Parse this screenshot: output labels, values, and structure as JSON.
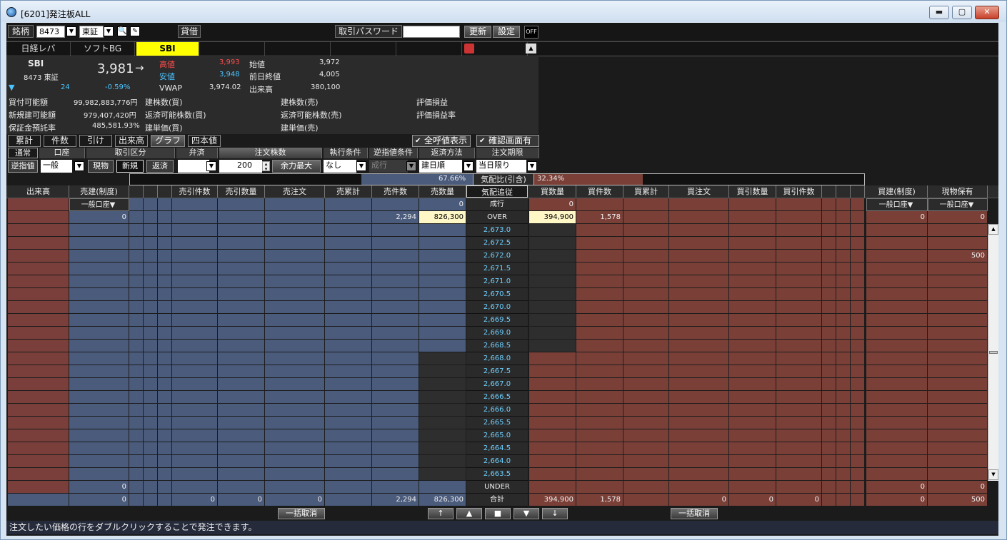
{
  "window": {
    "title": "[6201]発注板ALL",
    "minimize": "▬",
    "maximize": "▢",
    "close": "✕"
  },
  "toolbar": {
    "symbol_label": "銘柄",
    "symbol_value": "8473",
    "market_value": "東証",
    "loan_label": "貸借",
    "password_label": "取引パスワード",
    "password_value": "",
    "refresh": "更新",
    "settings": "設定",
    "off": "OFF"
  },
  "tabs": [
    "日経レバ",
    "ソフトBG",
    "SBI",
    "",
    "",
    "",
    "",
    ""
  ],
  "info": {
    "name": "SBI",
    "code": "8473 東証",
    "price": "3,981",
    "arrow": "→",
    "change": "24",
    "change_pct": "-0.59%",
    "high_label": "高値",
    "high": "3,993",
    "low_label": "安値",
    "low": "3,948",
    "vwap_label": "VWAP",
    "vwap": "3,974.02",
    "open_label": "始値",
    "open": "3,972",
    "prev_label": "前日終値",
    "prev": "4,005",
    "volume_label": "出来高",
    "volume": "380,100",
    "buying_power_label": "買付可能額",
    "buying_power": "99,982,883,776円",
    "new_margin_label": "新規建可能額",
    "new_margin": "979,407,420円",
    "deposit_label": "保証金預託率",
    "deposit": "485,581.93%",
    "pos_buy": "建株数(買)",
    "repay_buy": "返済可能株数(買)",
    "avg_buy": "建単価(買)",
    "pos_sell": "建株数(売)",
    "repay_sell": "返済可能株数(売)",
    "avg_sell": "建単価(売)",
    "eval_pl": "評価損益",
    "eval_pl_rate": "評価損益率"
  },
  "view_buttons": [
    "累計",
    "件数",
    "引け",
    "出来高",
    "グラフ",
    "四本値"
  ],
  "check_all_price": "全呼値表示",
  "check_confirm": "確認画面有",
  "order_headers": [
    "通常",
    "口座",
    "取引区分",
    "弁済",
    "注文株数",
    "執行条件",
    "逆指値条件",
    "返済方法",
    "注文期限"
  ],
  "order_values": {
    "stop": "逆指値",
    "account": "一般",
    "cash": "現物",
    "new": "新規",
    "repay": "返済",
    "bensai": "",
    "qty": "200",
    "max": "余力最大",
    "exec": "なし",
    "stop_cond": "成行",
    "repay_method": "建日順",
    "expiry": "当日限り"
  },
  "ratio": {
    "sell_pct_text": "67.66%",
    "label": "気配比(引含)",
    "buy_pct_text": "32.34%",
    "sell_pct": 67.66,
    "buy_pct": 32.34
  },
  "columns": [
    "出来高",
    "売建(制度)",
    "",
    "",
    "",
    "売引件数",
    "売引数量",
    "売注文",
    "売累計",
    "売件数",
    "売数量",
    "気配追従",
    "買数量",
    "買件数",
    "買累計",
    "買注文",
    "買引数量",
    "買引件数",
    "",
    "",
    "",
    "買建(制度)",
    "現物保有"
  ],
  "sub_header": {
    "sell_account": "一般口座▼",
    "market_order": "成行",
    "buy_account": "一般口座▼",
    "cash_account": "一般口座▼",
    "sell_qty": "0",
    "buy_qty": "0"
  },
  "over_row": {
    "label": "OVER",
    "sell_margin": "0",
    "sell_count": "2,294",
    "sell_qty": "826,300",
    "buy_qty": "394,900",
    "buy_count": "1,578",
    "buy_margin": "0",
    "cash_hold": "0"
  },
  "prices": [
    "2,673.0",
    "2,672.5",
    "2,672.0",
    "2,671.5",
    "2,671.0",
    "2,670.5",
    "2,670.0",
    "2,669.5",
    "2,669.0",
    "2,668.5",
    "2,668.0",
    "2,667.5",
    "2,667.0",
    "2,666.5",
    "2,666.0",
    "2,665.5",
    "2,665.0",
    "2,664.5",
    "2,664.0",
    "2,663.5"
  ],
  "row_cash_value": "500",
  "under_row": {
    "label": "UNDER",
    "sell_margin": "0",
    "buy_margin": "0",
    "cash_hold": "0"
  },
  "total_row": {
    "label": "合計",
    "sell_margin": "0",
    "sell_lim_count": "0",
    "sell_lim_qty": "0",
    "sell_order": "0",
    "sell_count": "2,294",
    "sell_qty": "826,300",
    "buy_qty": "394,900",
    "buy_count": "1,578",
    "buy_order": "0",
    "buy_lim_qty": "0",
    "buy_lim_count": "0",
    "buy_margin": "0",
    "cash_hold": "500"
  },
  "bottom": {
    "cancel_all": "一括取消",
    "up": "↑",
    "up_tri": "▲",
    "stop": "■",
    "down_tri": "▼",
    "down": "↓"
  },
  "status": "注文したい価格の行をダブルクリックすることで発注できます。",
  "colors": {
    "sell": "#4b5b7c",
    "buy": "#7a4038",
    "pinkcol": "#7a3f3b",
    "highlight": "#fff7c6",
    "price_bg": "#2a2a2a",
    "price_text": "#6fd0ff",
    "dark": "#2e2e2e"
  }
}
